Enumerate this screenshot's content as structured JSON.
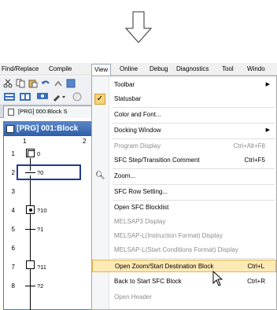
{
  "menubar": {
    "items": [
      "Find/Replace",
      "Compile",
      "View",
      "Online",
      "Debug",
      "Diagnostics",
      "Tool",
      "Windo"
    ]
  },
  "tab": {
    "label": "[PRG] 000:Block S"
  },
  "sfc_window": {
    "title": "[PRG] 001:Block",
    "col1": "1",
    "col2": "2",
    "rows": [
      {
        "num": "1",
        "label": "0"
      },
      {
        "num": "2",
        "label": "?0"
      },
      {
        "num": "3",
        "label": ""
      },
      {
        "num": "4",
        "label": "?10"
      },
      {
        "num": "5",
        "label": "?1"
      },
      {
        "num": "6",
        "label": ""
      },
      {
        "num": "7",
        "label": "?11"
      },
      {
        "num": "8",
        "label": "?2"
      }
    ],
    "dot": "·"
  },
  "view_menu": {
    "items": [
      {
        "label": "Toolbar",
        "shortcut": "",
        "submenu": true,
        "disabled": false
      },
      {
        "label": "Statusbar",
        "shortcut": "",
        "checked": true,
        "disabled": false
      },
      {
        "label": "Color and Font...",
        "shortcut": "",
        "disabled": false
      },
      {
        "label": "Docking Window",
        "shortcut": "",
        "submenu": true,
        "disabled": false
      },
      {
        "label": "Program Display",
        "shortcut": "Ctrl+Alt+F8",
        "disabled": true
      },
      {
        "label": "SFC Step/Transition Comment",
        "shortcut": "Ctrl+F5",
        "disabled": false
      },
      {
        "label": "Zoom...",
        "shortcut": "",
        "icon": "magnifier",
        "disabled": false
      },
      {
        "label": "SFC Row Setting...",
        "shortcut": "",
        "disabled": false
      },
      {
        "label": "Open SFC Blocklist",
        "shortcut": "",
        "disabled": false
      },
      {
        "label": "MELSAP3 Display",
        "shortcut": "",
        "disabled": true
      },
      {
        "label": "MELSAP-L(Instruction Format) Display",
        "shortcut": "",
        "disabled": true
      },
      {
        "label": "MELSAP-L(Start Conditions Format) Display",
        "shortcut": "",
        "disabled": true
      },
      {
        "label": "Open Zoom/Start Destination Block",
        "shortcut": "Ctrl+L",
        "disabled": false,
        "highlighted": true
      },
      {
        "label": "Back to Start SFC Block",
        "shortcut": "Ctrl+R",
        "disabled": false
      },
      {
        "label": "Open Header",
        "shortcut": "",
        "disabled": true
      }
    ]
  },
  "colors": {
    "menu_highlight": "#fde9b4",
    "title_bar": "#2e5ea8",
    "disabled_text": "#8d8d8d",
    "cursor_border": "#1f3c8f"
  }
}
